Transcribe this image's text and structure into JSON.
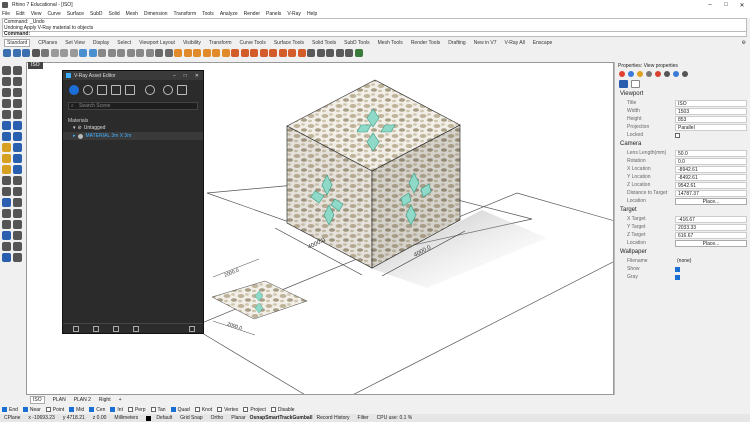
{
  "window": {
    "title": "Rhino 7 Educational - [ISO]"
  },
  "menu": [
    "File",
    "Edit",
    "View",
    "Curve",
    "Surface",
    "SubD",
    "Solid",
    "Mesh",
    "Dimension",
    "Transform",
    "Tools",
    "Analyze",
    "Render",
    "Panels",
    "V-Ray",
    "Help"
  ],
  "command_history": [
    "Command: _Undo",
    "Undoing Apply V-Ray material to objects"
  ],
  "command_prompt": "Command:",
  "toolbar_tabs": [
    "Standard",
    "CPlanes",
    "Set View",
    "Display",
    "Select",
    "Viewport Layout",
    "Visibility",
    "Transform",
    "Curve Tools",
    "Surface Tools",
    "Solid Tools",
    "SubD Tools",
    "Mesh Tools",
    "Render Tools",
    "Drafting",
    "New in V7",
    "V-Ray All",
    "Enscape"
  ],
  "viewport": {
    "label": "ISO"
  },
  "viewport_tabs": [
    "ISO",
    "PLAN",
    "PLAN 2",
    "Right"
  ],
  "osnaps": [
    {
      "label": "End",
      "on": true
    },
    {
      "label": "Near",
      "on": true
    },
    {
      "label": "Point",
      "on": false
    },
    {
      "label": "Mid",
      "on": true
    },
    {
      "label": "Cen",
      "on": true
    },
    {
      "label": "Int",
      "on": true
    },
    {
      "label": "Perp",
      "on": false
    },
    {
      "label": "Tan",
      "on": false
    },
    {
      "label": "Quad",
      "on": true
    },
    {
      "label": "Knot",
      "on": false
    },
    {
      "label": "Vertex",
      "on": false
    },
    {
      "label": "Project",
      "on": false
    },
    {
      "label": "Disable",
      "on": false
    }
  ],
  "status": {
    "cplane": "CPlane",
    "x": "x -10693.23",
    "y": "y 4718.21",
    "z": "z 0.00",
    "units": "Millimeters",
    "layer": "Default",
    "grid_snap": "Grid Snap",
    "ortho": "Ortho",
    "planar": "Planar",
    "osnap": "Osnap",
    "smarttrack": "SmartTrack",
    "gumball": "Gumball",
    "record": "Record History",
    "filter": "Filter",
    "cpu": "CPU use: 0.1 %"
  },
  "asset_editor": {
    "title": "V-Ray Asset Editor",
    "search_placeholder": "Search Scene",
    "section": "Materials",
    "group": "Untagged",
    "item": "MATERIAL 3m X 3m"
  },
  "dimensions": {
    "cube_left": "4000.0",
    "cube_right": "4000.0",
    "tile_a": "2000.0",
    "tile_b": "2000.0"
  },
  "properties": {
    "title": "Properties: View properties",
    "viewport_section": "Viewport",
    "title_label": "Title",
    "title_value": "ISO",
    "width_label": "Width",
    "width_value": "1503",
    "height_label": "Height",
    "height_value": "853",
    "projection_label": "Projection",
    "projection_value": "Parallel",
    "locked_label": "Locked",
    "camera_section": "Camera",
    "lens_label": "Lens Length(mm)",
    "lens_value": "50.0",
    "rotation_label": "Rotation",
    "rotation_value": "0.0",
    "xloc_label": "X Location",
    "xloc_value": "-8942.61",
    "yloc_label": "Y Location",
    "yloc_value": "-8492.61",
    "zloc_label": "Z Location",
    "zloc_value": "9542.61",
    "dist_label": "Distance to Target",
    "dist_value": "14787.37",
    "loc_label": "Location",
    "place_label": "Place...",
    "target_section": "Target",
    "xt_label": "X Target",
    "xt_value": "-416.67",
    "yt_label": "Y Target",
    "yt_value": "2033.33",
    "zt_label": "Z Target",
    "zt_value": "616.67",
    "tloc_label": "Location",
    "wall_section": "Wallpaper",
    "file_label": "Filename",
    "file_value": "(none)",
    "show_label": "Show",
    "gray_label": "Gray"
  }
}
